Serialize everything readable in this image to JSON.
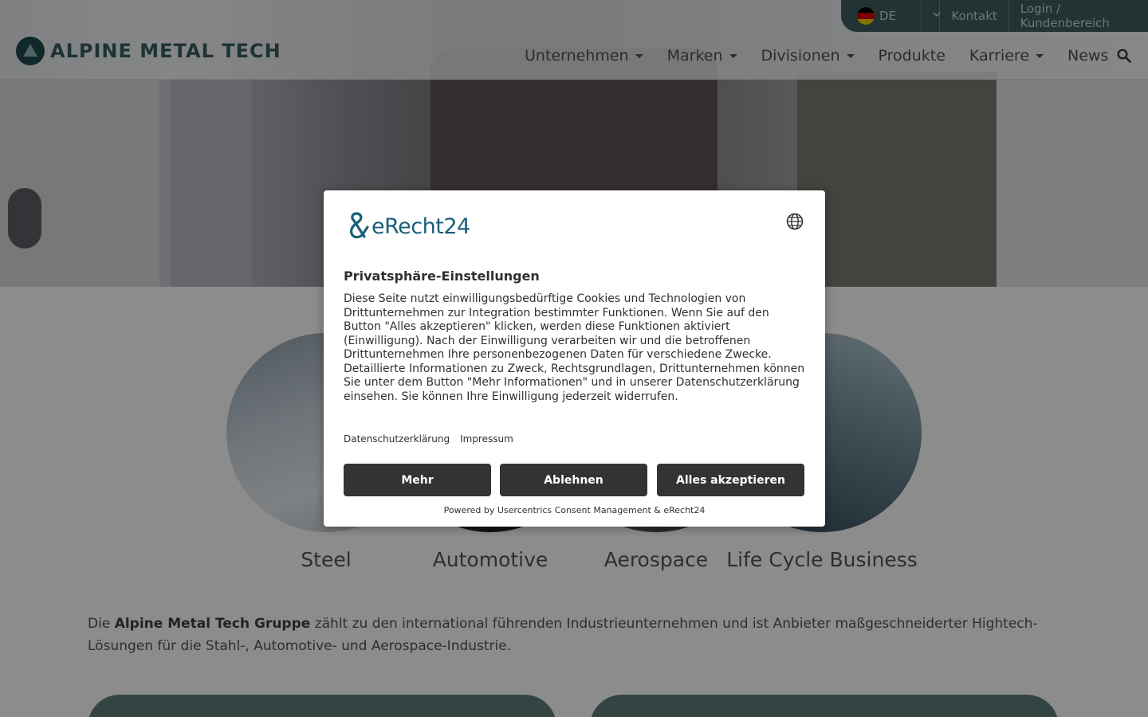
{
  "header": {
    "logo_text": "ALPINE METAL TECH",
    "topbar": {
      "language": "DE",
      "kontakt": "Kontakt",
      "login": "Login / Kundenbereich"
    },
    "nav": [
      {
        "label": "Unternehmen",
        "dropdown": true
      },
      {
        "label": "Marken",
        "dropdown": true
      },
      {
        "label": "Divisionen",
        "dropdown": true
      },
      {
        "label": "Produkte",
        "dropdown": false
      },
      {
        "label": "Karriere",
        "dropdown": true
      },
      {
        "label": "News",
        "dropdown": false
      }
    ]
  },
  "divisions": [
    {
      "label": "Steel"
    },
    {
      "label": "Automotive"
    },
    {
      "label": "Aerospace"
    },
    {
      "label": "Life Cycle Business"
    }
  ],
  "intro": {
    "prefix": "Die ",
    "bold": "Alpine Metal Tech Gruppe",
    "suffix": " zählt zu den international führenden Industrieunternehmen und ist Anbieter maßgeschneiderter Hightech-Lösungen für die Stahl-, Automotive- und Aerospace-Industrie."
  },
  "consent": {
    "brand": "eRecht24",
    "title": "Privatsphäre-Einstellungen",
    "body": "Diese Seite nutzt einwilligungsbedürftige Cookies und Technologien von Drittunternehmen zur Integration bestimmter Funktionen. Wenn Sie auf den Button \"Alles akzeptieren\" klicken, werden diese Funktionen aktiviert (Einwilligung). Nach der Einwilligung verarbeiten wir und die betroffenen Drittunternehmen Ihre personenbezogenen Daten für verschiedene Zwecke. Detaillierte Informationen zu Zweck, Rechtsgrundlagen, Drittunternehmen können Sie unter dem Button \"Mehr Informationen\" und in unserer Datenschutzerklärung einsehen. Sie können Ihre Einwilligung jederzeit widerrufen.",
    "links": {
      "privacy": "Datenschutzerklärung",
      "imprint": "Impressum"
    },
    "buttons": {
      "more": "Mehr",
      "deny": "Ablehnen",
      "accept": "Alles akzeptieren"
    },
    "powered": "Powered by Usercentrics Consent Management & eRecht24"
  },
  "colors": {
    "brand_teal": "#3c5e5e",
    "dialog_button": "#333333",
    "erecht_blue": "#1a5f7a"
  },
  "icons": [
    "logo-mark-icon",
    "flag-de-icon",
    "chevron-down-icon",
    "search-icon",
    "erecht24-logo-icon",
    "globe-icon"
  ]
}
